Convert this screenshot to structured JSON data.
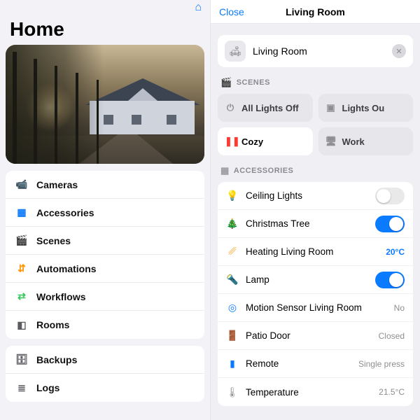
{
  "left": {
    "title": "Home",
    "menu1": [
      {
        "icon": "📹",
        "color": "#6b4de6",
        "label": "Cameras"
      },
      {
        "icon": "▦",
        "color": "#0a7aff",
        "label": "Accessories"
      },
      {
        "icon": "🎬",
        "color": "#ff3b30",
        "label": "Scenes"
      },
      {
        "icon": "⇵",
        "color": "#ff9500",
        "label": "Automations"
      },
      {
        "icon": "⇄",
        "color": "#34c759",
        "label": "Workflows"
      },
      {
        "icon": "◧",
        "color": "#5b5b60",
        "label": "Rooms"
      }
    ],
    "menu2": [
      {
        "icon": "🗄",
        "color": "#5b5b60",
        "label": "Backups"
      },
      {
        "icon": "≣",
        "color": "#5b5b60",
        "label": "Logs"
      }
    ]
  },
  "right": {
    "close": "Close",
    "title": "Living Room",
    "room_name": "Living Room",
    "scenes_label": "SCENES",
    "accessories_label": "ACCESSORIES",
    "scenes": [
      {
        "icon": "⏻",
        "label": "All Lights Off",
        "active": false,
        "icolor": "#8e8e93"
      },
      {
        "icon": "▣",
        "label": "Lights Ou",
        "active": false,
        "icolor": "#8e8e93"
      },
      {
        "icon": "❚❚",
        "label": "Cozy",
        "active": true,
        "icolor": "#ff3b30"
      },
      {
        "icon": "🖥",
        "label": "Work",
        "active": false,
        "icolor": "#8e8e93"
      }
    ],
    "accessories": [
      {
        "icon": "💡",
        "icolor": "#0a7aff",
        "label": "Ceiling Lights",
        "type": "toggle",
        "on": false
      },
      {
        "icon": "🎄",
        "icolor": "#0a7aff",
        "label": "Christmas Tree",
        "type": "toggle",
        "on": true
      },
      {
        "icon": "␥",
        "icolor": "#ff9500",
        "label": "Heating Living Room",
        "type": "value",
        "value": "20°C",
        "blue": true
      },
      {
        "icon": "🔦",
        "icolor": "#0a7aff",
        "label": "Lamp",
        "type": "toggle",
        "on": true
      },
      {
        "icon": "◎",
        "icolor": "#0a7aff",
        "label": "Motion Sensor Living Room",
        "type": "value",
        "value": "No"
      },
      {
        "icon": "🚪",
        "icolor": "#8e8e93",
        "label": "Patio Door",
        "type": "value",
        "value": "Closed"
      },
      {
        "icon": "▮",
        "icolor": "#0a7aff",
        "label": "Remote",
        "type": "value",
        "value": "Single press"
      },
      {
        "icon": "🌡",
        "icolor": "#8e8e93",
        "label": "Temperature",
        "type": "value",
        "value": "21.5°C"
      }
    ]
  }
}
